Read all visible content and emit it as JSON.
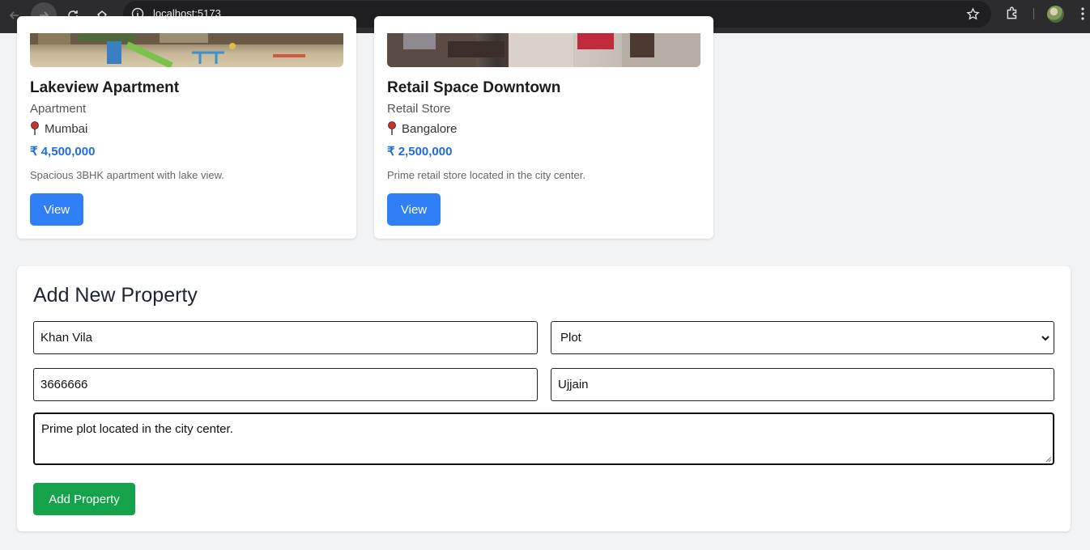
{
  "browser": {
    "url": "localhost:5173"
  },
  "properties": [
    {
      "title": "Lakeview Apartment",
      "type": "Apartment",
      "location": "Mumbai",
      "price": "₹ 4,500,000",
      "description": "Spacious 3BHK apartment with lake view.",
      "view_label": "View"
    },
    {
      "title": "Retail Space Downtown",
      "type": "Retail Store",
      "location": "Bangalore",
      "price": "₹ 2,500,000",
      "description": "Prime retail store located in the city center.",
      "view_label": "View"
    }
  ],
  "form": {
    "title": "Add New Property",
    "name_value": "Khan Vila",
    "type_value": "Plot",
    "price_value": "3666666",
    "location_value": "Ujjain",
    "description_value": "Prime plot located in the city center.",
    "submit_label": "Add Property"
  },
  "colors": {
    "accent_blue": "#2f80f6",
    "price_blue": "#1e6ce0",
    "submit_green": "#14a34a"
  }
}
